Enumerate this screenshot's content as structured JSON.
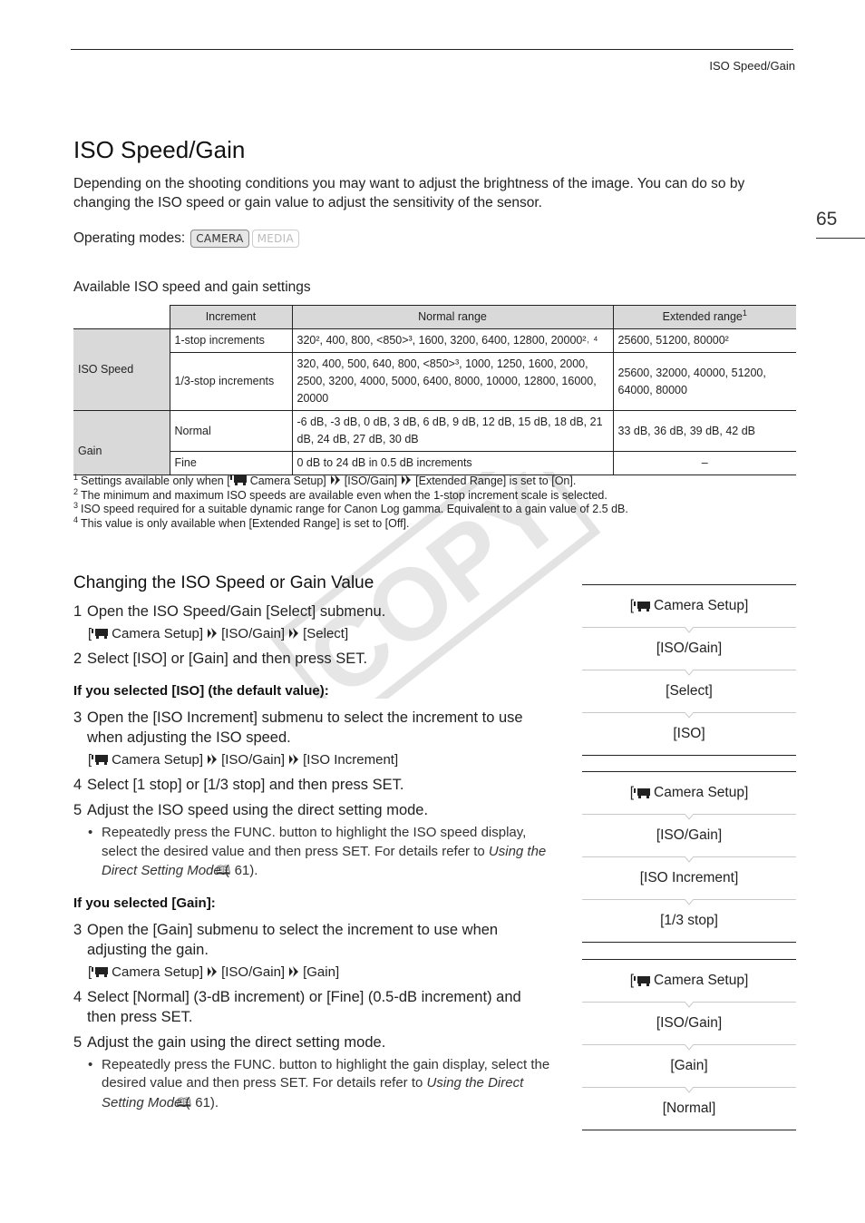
{
  "running_head": "ISO Speed/Gain",
  "page_number": "65",
  "title": "ISO Speed/Gain",
  "intro": "Depending on the shooting conditions you may want to adjust the brightness of the image. You can do so by changing the ISO speed or gain value to adjust the sensitivity of the sensor.",
  "operating_modes": {
    "label": "Operating modes:",
    "modes": [
      {
        "label": "CAMERA",
        "active": true
      },
      {
        "label": "MEDIA",
        "active": false
      }
    ]
  },
  "table": {
    "caption": "Available ISO speed and gain settings",
    "headers": [
      "Increment",
      "Normal range",
      "Extended range"
    ],
    "extended_header_footnote": "1",
    "groups": [
      {
        "label": "ISO Speed",
        "rows": [
          {
            "increment": "1-stop increments",
            "normal": "320², 400, 800, <850>³, 1600, 3200, 6400, 12800, 20000²˒ ⁴",
            "extended": "25600, 51200, 80000²"
          },
          {
            "increment": "1/3-stop increments",
            "normal": "320, 400, 500, 640, 800, <850>³, 1000, 1250, 1600, 2000, 2500, 3200, 4000, 5000, 6400, 8000, 10000, 12800, 16000, 20000",
            "extended": "25600, 32000, 40000, 51200, 64000, 80000"
          }
        ]
      },
      {
        "label": "Gain",
        "rows": [
          {
            "increment": "Normal",
            "normal": "-6 dB, -3 dB, 0 dB, 3 dB, 6 dB, 9 dB, 12 dB, 15 dB, 18 dB, 21 dB, 24 dB, 27 dB, 30 dB",
            "extended": "33 dB, 36 dB, 39 dB, 42 dB"
          },
          {
            "increment": "Fine",
            "normal": "0 dB to 24 dB in 0.5 dB increments",
            "extended": "–"
          }
        ]
      }
    ]
  },
  "footnotes": [
    {
      "num": "1",
      "pre": "Settings available only when [",
      "path": [
        "Camera Setup]",
        "[ISO/Gain]",
        "[Extended Range] is set to [On]."
      ]
    },
    {
      "num": "2",
      "text": "The minimum and maximum ISO speeds are available even when the 1-stop increment scale is selected."
    },
    {
      "num": "3",
      "text": "ISO speed required for a suitable dynamic range for Canon Log gamma. Equivalent to a gain value of 2.5 dB."
    },
    {
      "num": "4",
      "text": "This value is only available when [Extended Range] is set to [Off]."
    }
  ],
  "section": {
    "title": "Changing the ISO Speed or Gain Value",
    "steps_common": [
      {
        "num": "1",
        "text": "Open the ISO Speed/Gain [Select] submenu.",
        "path": [
          "Camera Setup]",
          "[ISO/Gain]",
          "[Select]"
        ]
      },
      {
        "num": "2",
        "text": "Select [ISO] or [Gain] and then press SET."
      }
    ],
    "iso_heading": "If you selected [ISO] (the default value):",
    "steps_iso": [
      {
        "num": "3",
        "text": "Open the [ISO Increment] submenu to select the increment to use when adjusting the ISO speed.",
        "path": [
          "Camera Setup]",
          "[ISO/Gain]",
          "[ISO Increment]"
        ]
      },
      {
        "num": "4",
        "text": "Select [1 stop] or [1/3 stop] and then press SET."
      },
      {
        "num": "5",
        "text": "Adjust the ISO speed using the direct setting mode.",
        "bullet": {
          "pre": "Repeatedly press the FUNC. button to highlight the ISO speed display, select the desired value and then press SET. For details refer to ",
          "link": "Using the Direct Setting Mode",
          "ref": " 61)."
        }
      }
    ],
    "gain_heading": "If you selected [Gain]:",
    "steps_gain": [
      {
        "num": "3",
        "text": "Open the [Gain] submenu to select the increment to use when adjusting the gain.",
        "path": [
          "Camera Setup]",
          "[ISO/Gain]",
          "[Gain]"
        ]
      },
      {
        "num": "4",
        "text": "Select [Normal] (3-dB increment) or [Fine] (0.5-dB increment) and then press SET."
      },
      {
        "num": "5",
        "text": "Adjust the gain using the direct setting mode.",
        "bullet": {
          "pre": "Repeatedly press the FUNC. button to highlight the gain display, select the desired value and then press SET. For details refer to ",
          "link": "Using the Direct Setting Mode",
          "ref": " 61)."
        }
      }
    ]
  },
  "menu_boxes": [
    [
      "Camera Setup]",
      "[ISO/Gain]",
      "[Select]",
      "[ISO]"
    ],
    [
      "Camera Setup]",
      "[ISO/Gain]",
      "[ISO Increment]",
      "[1/3 stop]"
    ],
    [
      "Camera Setup]",
      "[ISO/Gain]",
      "[Gain]",
      "[Normal]"
    ]
  ],
  "watermark": "COPY",
  "colors": {
    "table_header_bg": "#d9d9d9",
    "watermark": "#e6e6e6"
  }
}
